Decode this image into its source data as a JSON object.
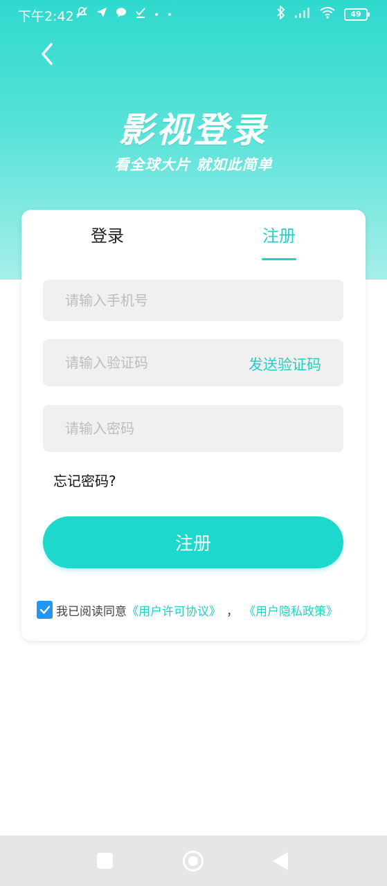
{
  "status_bar": {
    "time": "下午2:42",
    "battery": "49",
    "left_icons": [
      "mute-icon",
      "send-icon",
      "chat-icon",
      "check-icon",
      "more-dots-icon"
    ],
    "right_icons": [
      "bluetooth-icon",
      "signal-icon",
      "wifi-icon",
      "battery-icon"
    ]
  },
  "hero": {
    "title": "影视登录",
    "subtitle": "看全球大片 就如此简单"
  },
  "tabs": {
    "login": "登录",
    "register": "注册",
    "active": "register"
  },
  "form": {
    "phone_placeholder": "请输入手机号",
    "code_placeholder": "请输入验证码",
    "send_code_label": "发送验证码",
    "password_placeholder": "请输入密码",
    "forgot_label": "忘记密码?",
    "submit_label": "注册"
  },
  "agreement": {
    "checked": true,
    "prefix": "我已阅读同意",
    "user_agreement": "《用户许可协议》",
    "separator": "，",
    "privacy_policy": "《用户隐私政策》"
  },
  "colors": {
    "accent": "#22cfc4",
    "button": "#1ed8cd",
    "checkbox": "#2196f3"
  }
}
